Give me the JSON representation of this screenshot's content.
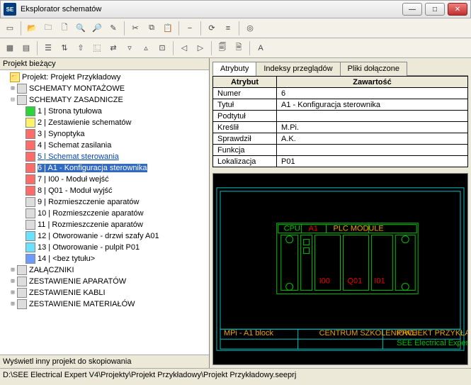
{
  "window": {
    "title": "Eksplorator schematów"
  },
  "left": {
    "header": "Projekt bieżący",
    "root": "Projekt: Projekt Przykładowy",
    "g1": "SCHEMATY MONTAŻOWE",
    "g2": "SCHEMATY ZASADNICZE",
    "items": [
      "1 | Strona tytułowa",
      "2 | Zestawienie schematów",
      "3 | Synoptyka",
      "4 | Schemat zasilania",
      "5 | Schemat sterowania",
      "6 | A1 - Konfiguracja sterownika",
      "7 | I00 - Moduł wejść",
      "8 | Q01 - Moduł wyjść",
      "9 | Rozmieszczenie aparatów",
      "10 | Rozmieszczenie aparatów",
      "11 | Rozmieszczenie aparatów",
      "12 | Otworowanie - drzwi szafy A01",
      "13 | Otworowanie - pulpit P01",
      "14 | <bez tytułu>"
    ],
    "g3": "ZAŁĄCZNIKI",
    "g4": "ZESTAWIENIE APARATÓW",
    "g5": "ZESTAWIENIE KABLI",
    "g6": "ZESTAWIENIE MATERIAŁÓW",
    "footer": "Wyświetl inny projekt do skopiowania"
  },
  "tabs": {
    "t1": "Atrybuty",
    "t2": "Indeksy przeglądów",
    "t3": "Pliki dołączone"
  },
  "table": {
    "h1": "Atrybut",
    "h2": "Zawartość",
    "rows": [
      {
        "a": "Numer",
        "v": "6"
      },
      {
        "a": "Tytuł",
        "v": "A1 - Konfiguracja sterownika"
      },
      {
        "a": "Podtytuł",
        "v": ""
      },
      {
        "a": "Kreślił",
        "v": "M.Pi."
      },
      {
        "a": "Sprawdził",
        "v": "A.K."
      },
      {
        "a": "Funkcja",
        "v": ""
      },
      {
        "a": "Lokalizacja",
        "v": "P01"
      }
    ]
  },
  "status": {
    "path": "D:\\SEE Electrical Expert V4\\Projekty\\Projekt Przykładowy\\Projekt Przykładowy.seeprj"
  }
}
